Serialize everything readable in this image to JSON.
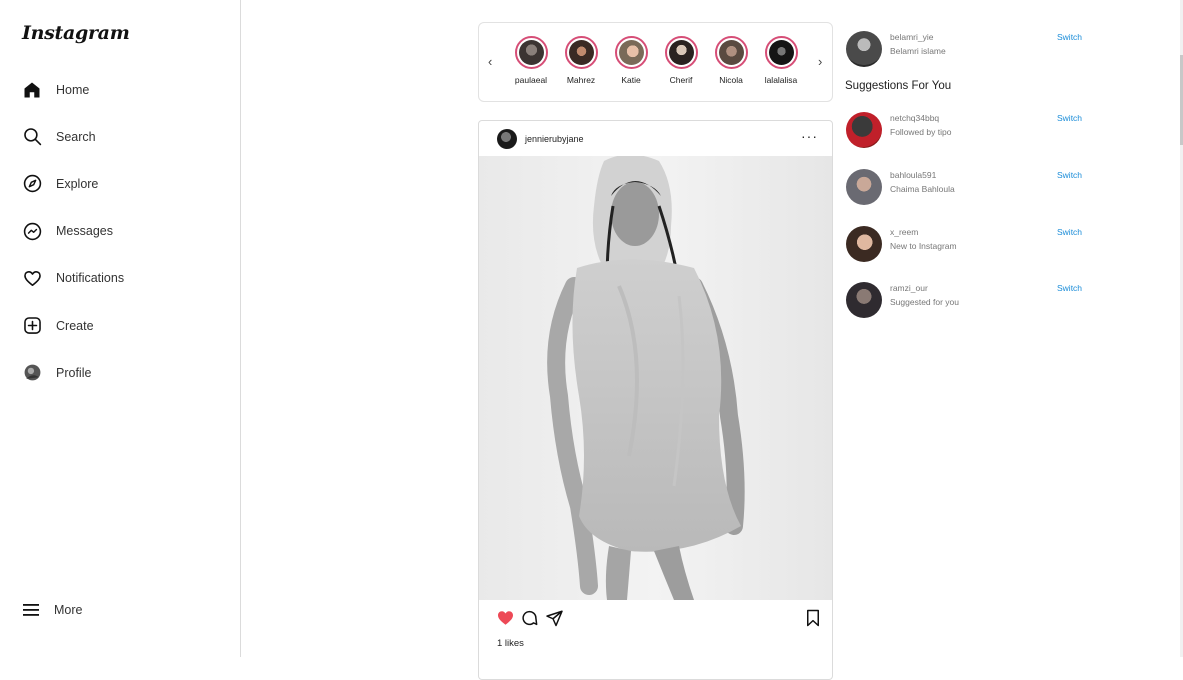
{
  "brand": {
    "logo_text": "Instagram"
  },
  "sidebar": {
    "items": [
      {
        "label": "Home",
        "icon": "home-icon"
      },
      {
        "label": "Search",
        "icon": "search-icon"
      },
      {
        "label": "Explore",
        "icon": "compass-icon"
      },
      {
        "label": "Messages",
        "icon": "messenger-icon"
      },
      {
        "label": "Notifications",
        "icon": "heart-icon"
      },
      {
        "label": "Create",
        "icon": "plus-square-icon"
      },
      {
        "label": "Profile",
        "icon": "avatar-icon"
      }
    ],
    "more_label": "More"
  },
  "stories": {
    "prev_arrow": "‹",
    "next_arrow": "›",
    "items": [
      {
        "name": "paulaeal"
      },
      {
        "name": "Mahrez"
      },
      {
        "name": "Katie"
      },
      {
        "name": "Cherif"
      },
      {
        "name": "Nicola"
      },
      {
        "name": "lalalalisa"
      }
    ]
  },
  "post": {
    "username": "jennierubyjane",
    "menu": "···",
    "likes_text": "1 likes",
    "liked": true,
    "like_color": "#ed4956"
  },
  "account": {
    "username": "belamri_yie",
    "full_name": "Belamri islame",
    "switch_label": "Switch"
  },
  "suggestions": {
    "title": "Suggestions For You",
    "items": [
      {
        "username": "netchq34bbq",
        "subtitle": "Followed by tipo",
        "action": "Switch"
      },
      {
        "username": "bahloula591",
        "subtitle": "Chaima Bahloula",
        "action": "Switch"
      },
      {
        "username": "x_reem",
        "subtitle": "New to Instagram",
        "action": "Switch"
      },
      {
        "username": "ramzi_our",
        "subtitle": "Suggested for you",
        "action": "Switch"
      }
    ]
  },
  "colors": {
    "accent": "#1a8cd8",
    "story_ring": "#d64e77",
    "border": "#dbdbdb"
  }
}
